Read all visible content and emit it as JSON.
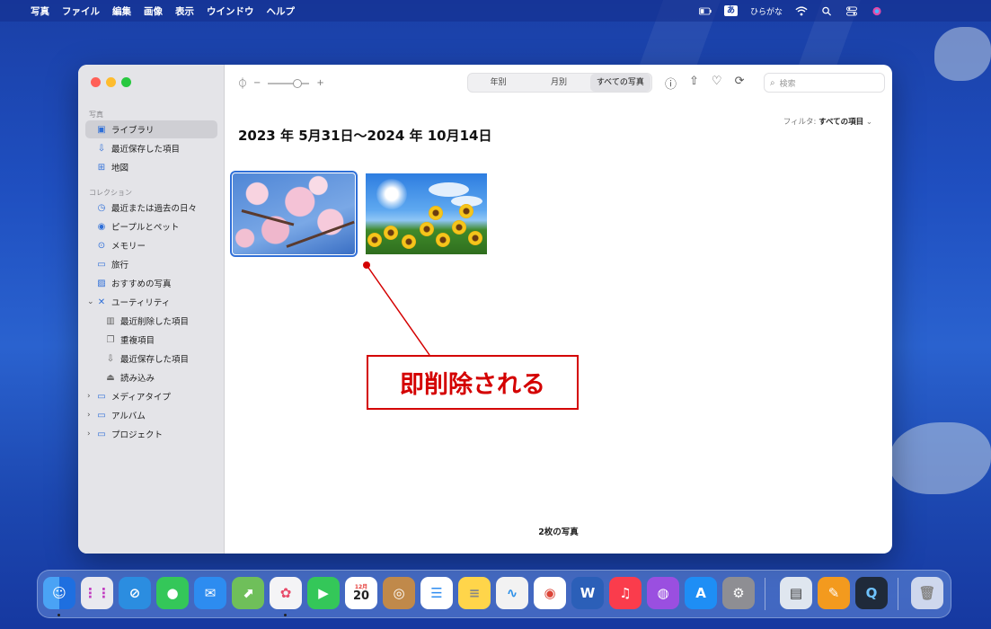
{
  "menubar": {
    "apple": "",
    "app_name": "写真",
    "menus": [
      "ファイル",
      "編集",
      "画像",
      "表示",
      "ウインドウ",
      "ヘルプ"
    ],
    "ime_badge": "あ",
    "ime_label": "ひらがな"
  },
  "sidebar": {
    "section_photos": "写真",
    "library": "ライブラリ",
    "recently_saved": "最近保存した項目",
    "map": "地図",
    "section_collections": "コレクション",
    "recent_days": "最近または過去の日々",
    "people_pets": "ピープルとペット",
    "memories": "メモリー",
    "trips": "旅行",
    "featured": "おすすめの写真",
    "utilities": "ユーティリティ",
    "recently_deleted": "最近削除した項目",
    "duplicates": "重複項目",
    "recently_saved_2": "最近保存した項目",
    "imports": "読み込み",
    "media_types": "メディアタイプ",
    "albums": "アルバム",
    "projects": "プロジェクト"
  },
  "toolbar": {
    "zoom_minus": "−",
    "zoom_plus": "+",
    "tabs": [
      "年別",
      "月別",
      "すべての写真"
    ],
    "selected_tab": "すべての写真",
    "search_placeholder": "検索"
  },
  "content": {
    "date_range": "2023 年 5月31日〜2024 年 10月14日",
    "filter_label": "フィルタ:",
    "filter_value": "すべての項目",
    "photo_count": "2枚の写真"
  },
  "annotation": {
    "text": "即削除される",
    "color": "#d40000"
  },
  "dock": {
    "calendar_month": "12月",
    "calendar_day": "20"
  },
  "colors": {
    "accent": "#2f6fd8",
    "sidebar_bg": "#e4e4e8"
  }
}
